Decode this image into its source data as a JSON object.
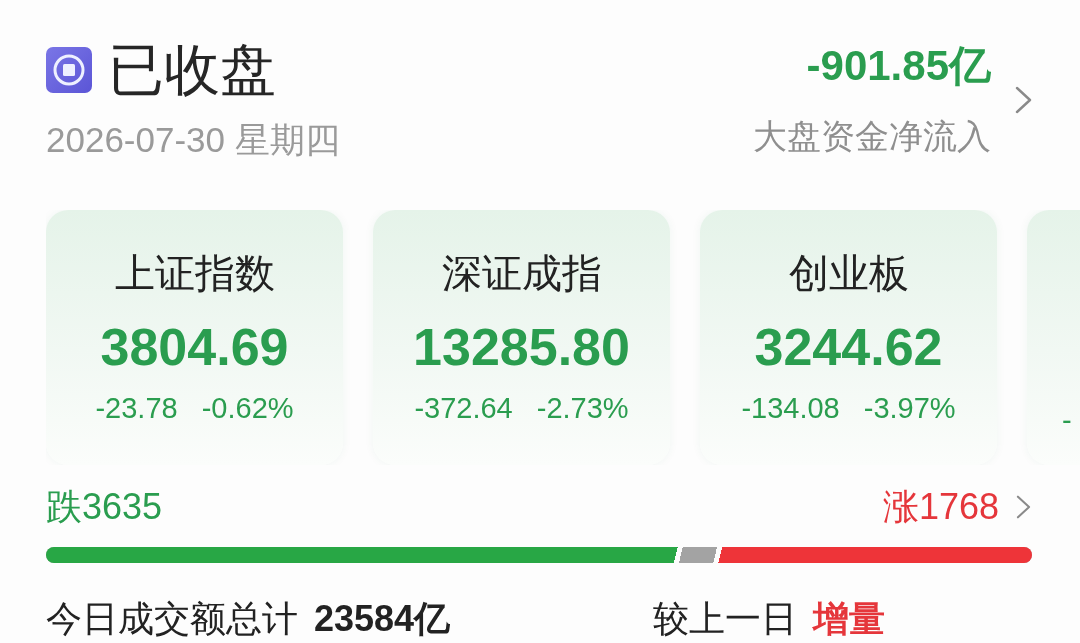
{
  "header": {
    "title": "已收盘",
    "date": "2026-07-30 星期四"
  },
  "fund_flow": {
    "value": "-901.85亿",
    "label": "大盘资金净流入"
  },
  "indices": [
    {
      "name": "上证指数",
      "value": "3804.69",
      "change": "-23.78",
      "change_pct": "-0.62%"
    },
    {
      "name": "深证成指",
      "value": "13285.80",
      "change": "-372.64",
      "change_pct": "-2.73%"
    },
    {
      "name": "创业板",
      "value": "3244.62",
      "change": "-134.08",
      "change_pct": "-3.97%"
    },
    {
      "change": "-"
    }
  ],
  "breadth": {
    "fall_label": "跌",
    "fall_count": "3635",
    "rise_label": "涨",
    "rise_count": "1768",
    "fills": [
      {
        "kind": "fall",
        "level": 0.646,
        "color": "#28a745"
      },
      {
        "kind": "flat",
        "color": "#a3a3a3"
      },
      {
        "kind": "rise",
        "level": 0.324,
        "color": "#ee3439"
      }
    ]
  },
  "turnover": {
    "label": "今日成交额总计",
    "value": "23584亿",
    "compare_label": "较上一日",
    "compare_value": "增量"
  }
}
